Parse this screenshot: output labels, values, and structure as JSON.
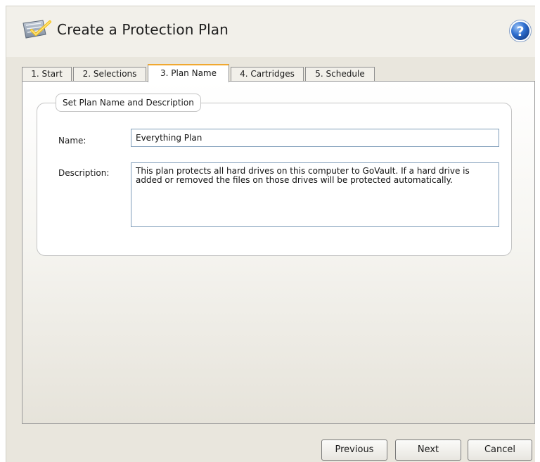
{
  "window": {
    "title": "Create a Protection Plan",
    "title_icon": "plan-checklist-icon",
    "help_icon": "help-question-icon"
  },
  "tabs": [
    {
      "label": "1. Start"
    },
    {
      "label": "2. Selections"
    },
    {
      "label": "3. Plan Name",
      "active": true
    },
    {
      "label": "4. Cartridges"
    },
    {
      "label": "5. Schedule"
    }
  ],
  "group": {
    "legend": "Set Plan Name and Description",
    "name_label": "Name:",
    "name_value": "Everything Plan",
    "description_label": "Description:",
    "description_value": "This plan protects all hard drives on this computer to GoVault. If a hard drive is added or removed the files on those drives will be protected automatically."
  },
  "buttons": {
    "previous": "Previous",
    "next": "Next",
    "cancel": "Cancel"
  },
  "colors": {
    "active_tab_accent": "#f0a830",
    "help_icon_blue": "#2f6fd0",
    "window_background": "#e9e6dd"
  }
}
